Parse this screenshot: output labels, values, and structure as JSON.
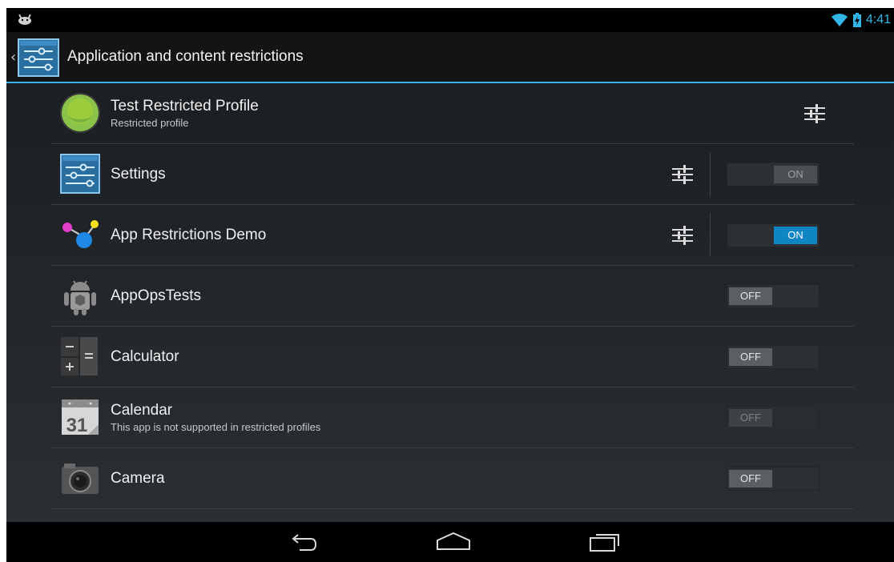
{
  "status_bar": {
    "time": "4:41",
    "icons": [
      "android-notification-icon",
      "wifi-icon",
      "battery-charging-icon"
    ],
    "accent": "#33b5e5"
  },
  "action_bar": {
    "title": "Application and content restrictions",
    "icon": "settings-sliders-icon"
  },
  "profile": {
    "name": "Test Restricted Profile",
    "subtitle": "Restricted profile",
    "icon": "profile-avatar-icon"
  },
  "apps": [
    {
      "name": "Settings",
      "icon": "settings-app-icon",
      "has_settings": true,
      "toggle": "ON",
      "state": "on",
      "active": false,
      "subtitle": ""
    },
    {
      "name": "App Restrictions Demo",
      "icon": "molecule-icon",
      "has_settings": true,
      "toggle": "ON",
      "state": "on",
      "active": true,
      "subtitle": ""
    },
    {
      "name": "AppOpsTests",
      "icon": "android-robot-icon",
      "has_settings": false,
      "toggle": "OFF",
      "state": "off",
      "subtitle": ""
    },
    {
      "name": "Calculator",
      "icon": "calculator-icon",
      "has_settings": false,
      "toggle": "OFF",
      "state": "off",
      "subtitle": ""
    },
    {
      "name": "Calendar",
      "icon": "calendar-icon",
      "has_settings": false,
      "toggle": "OFF",
      "state": "off",
      "disabled": true,
      "subtitle": "This app is not supported in restricted profiles",
      "calendar_day": "31"
    },
    {
      "name": "Camera",
      "icon": "camera-icon",
      "has_settings": false,
      "toggle": "OFF",
      "state": "off",
      "subtitle": ""
    }
  ],
  "nav_bar": {
    "buttons": [
      "back-icon",
      "home-icon",
      "recent-apps-icon"
    ]
  }
}
